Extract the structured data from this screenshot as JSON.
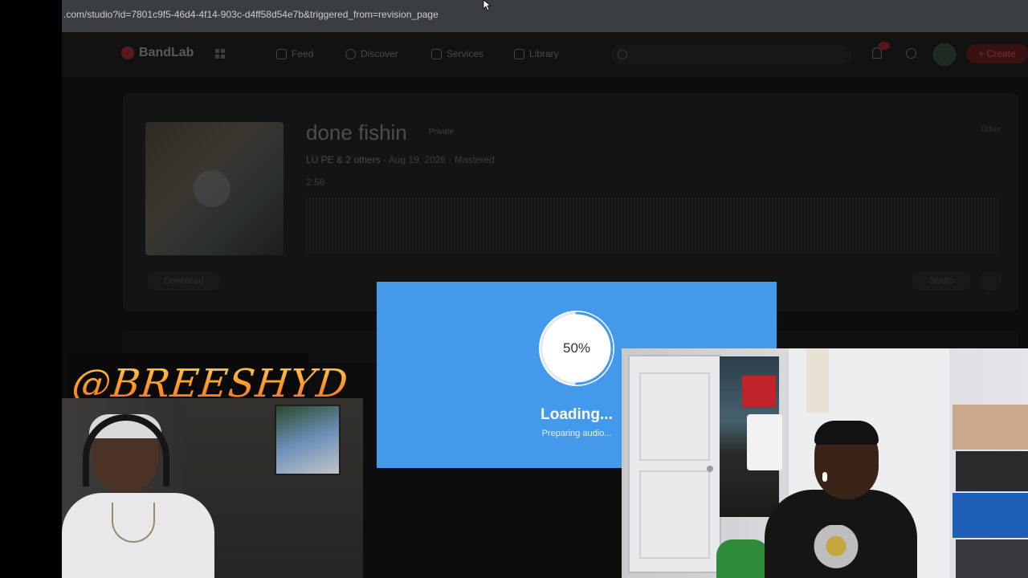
{
  "browser": {
    "url": ".com/studio?id=7801c9f5-46d4-4f14-903c-d4ff58d54e7b&triggered_from=revision_page"
  },
  "nav": {
    "brand": "BandLab",
    "items": [
      {
        "label": "Feed",
        "icon": "home-icon"
      },
      {
        "label": "Discover",
        "icon": "compass-icon"
      },
      {
        "label": "Services",
        "icon": "star-icon"
      },
      {
        "label": "Library",
        "icon": "library-icon"
      }
    ],
    "search_placeholder": "Search",
    "notification_count": "9",
    "create_label": "+ Create"
  },
  "track": {
    "title": "done fishin",
    "visibility": "Private",
    "artists": "LU PE & 2 others",
    "meta": "· Aug 19, 2026 · Mastered",
    "duration": "2:58",
    "other_label": "Other",
    "download_label": "Download",
    "studio_label": "Studio"
  },
  "loading_modal": {
    "progress": 50,
    "progress_label": "50%",
    "title": "Loading...",
    "subtitle": "Preparing audio...",
    "accent_color": "#4399ea"
  },
  "overlay": {
    "handle": "@BREESHYD"
  }
}
